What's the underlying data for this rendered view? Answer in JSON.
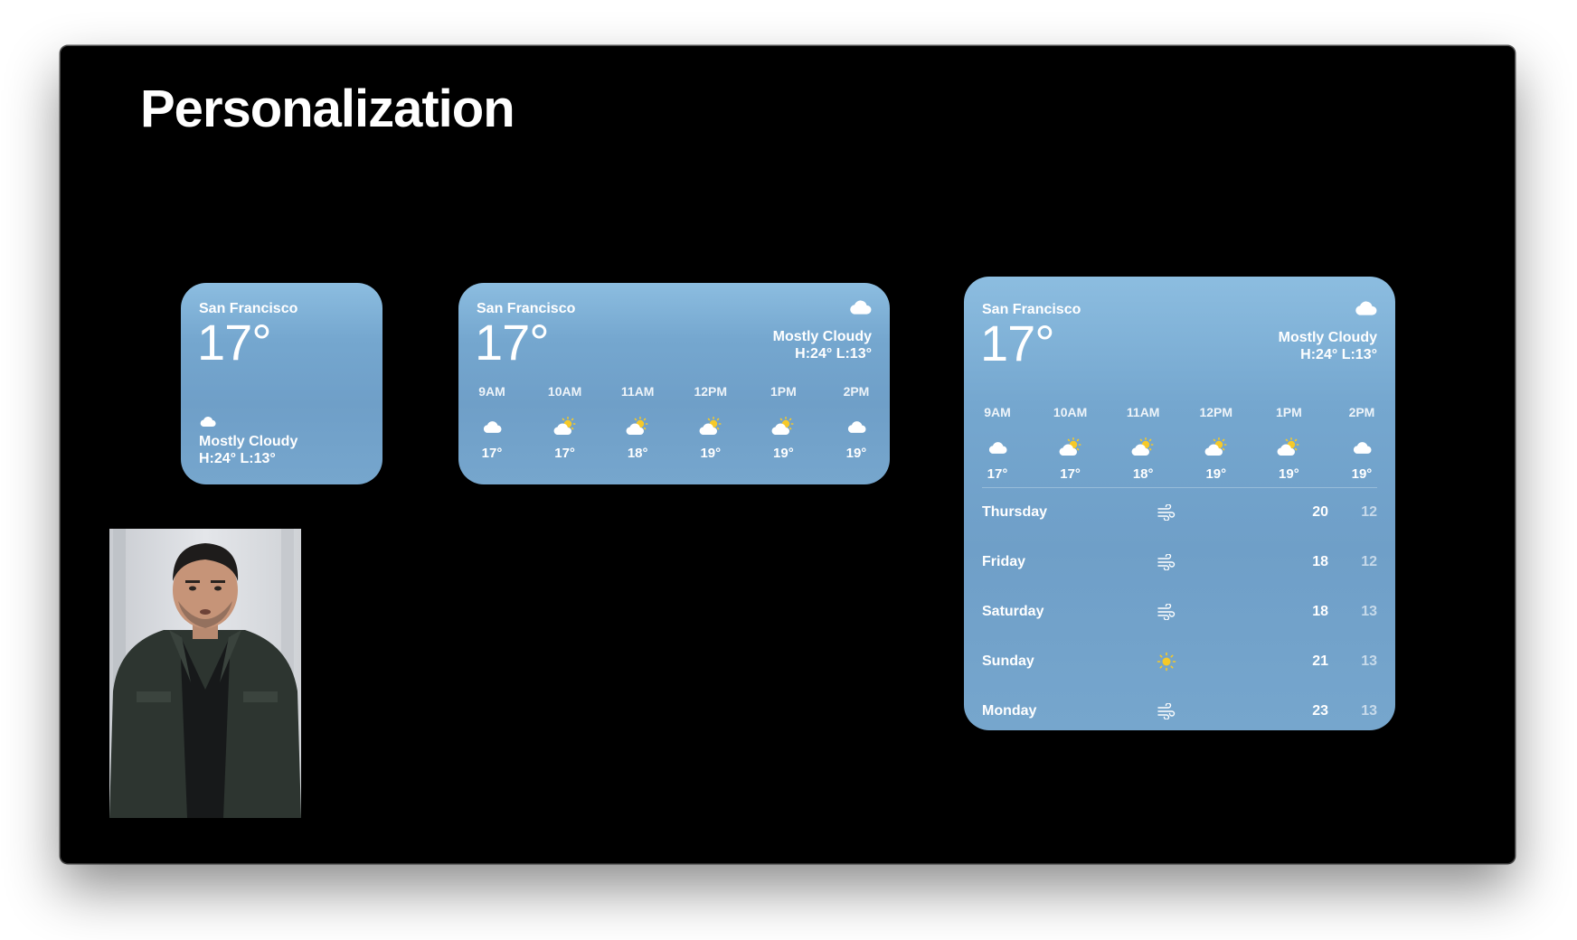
{
  "slide": {
    "title": "Personalization"
  },
  "colors": {
    "widget_top": "#8cbde0",
    "widget_bottom": "#6f9fc8",
    "sun": "#f6c928"
  },
  "small_widget": {
    "city": "San Francisco",
    "temp": "17°",
    "condition": "Mostly Cloudy",
    "high_low": "H:24° L:13°",
    "icon": "cloud-icon"
  },
  "medium_widget": {
    "city": "San Francisco",
    "temp": "17°",
    "condition": "Mostly Cloudy",
    "high_low": "H:24° L:13°",
    "icon": "cloud-icon",
    "hourly": [
      {
        "time": "9AM",
        "icon": "cloud",
        "temp": "17°"
      },
      {
        "time": "10AM",
        "icon": "partly-cloudy",
        "temp": "17°"
      },
      {
        "time": "11AM",
        "icon": "partly-cloudy",
        "temp": "18°"
      },
      {
        "time": "12PM",
        "icon": "partly-cloudy",
        "temp": "19°"
      },
      {
        "time": "1PM",
        "icon": "partly-cloudy",
        "temp": "19°"
      },
      {
        "time": "2PM",
        "icon": "cloud",
        "temp": "19°"
      }
    ]
  },
  "large_widget": {
    "city": "San Francisco",
    "temp": "17°",
    "condition": "Mostly Cloudy",
    "high_low": "H:24° L:13°",
    "icon": "cloud-icon",
    "hourly": [
      {
        "time": "9AM",
        "icon": "cloud",
        "temp": "17°"
      },
      {
        "time": "10AM",
        "icon": "partly-cloudy",
        "temp": "17°"
      },
      {
        "time": "11AM",
        "icon": "partly-cloudy",
        "temp": "18°"
      },
      {
        "time": "12PM",
        "icon": "partly-cloudy",
        "temp": "19°"
      },
      {
        "time": "1PM",
        "icon": "partly-cloudy",
        "temp": "19°"
      },
      {
        "time": "2PM",
        "icon": "cloud",
        "temp": "19°"
      }
    ],
    "daily": [
      {
        "day": "Thursday",
        "icon": "wind",
        "high": "20",
        "low": "12"
      },
      {
        "day": "Friday",
        "icon": "wind",
        "high": "18",
        "low": "12"
      },
      {
        "day": "Saturday",
        "icon": "wind",
        "high": "18",
        "low": "13"
      },
      {
        "day": "Sunday",
        "icon": "sun",
        "high": "21",
        "low": "13"
      },
      {
        "day": "Monday",
        "icon": "wind",
        "high": "23",
        "low": "13"
      }
    ]
  },
  "presenter": {
    "icon": "presenter-video"
  }
}
